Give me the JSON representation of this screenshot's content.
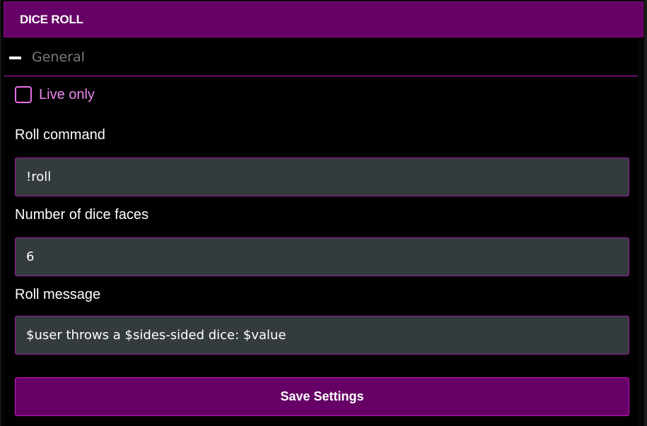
{
  "header": {
    "title": "DICE ROLL"
  },
  "section": {
    "title": "General",
    "collapse_icon": "minus-icon"
  },
  "live_only": {
    "label": "Live only",
    "checked": false
  },
  "fields": [
    {
      "label": "Roll command",
      "value": "!roll"
    },
    {
      "label": "Number of dice faces",
      "value": "6"
    },
    {
      "label": "Roll message",
      "value": "$user throws a $sides-sided dice: $value"
    }
  ],
  "save_button": {
    "label": "Save Settings"
  },
  "colors": {
    "accent": "#660066",
    "border": "#c814c8",
    "checkbox_label": "#ee88ee",
    "input_bg": "#343b3e"
  }
}
